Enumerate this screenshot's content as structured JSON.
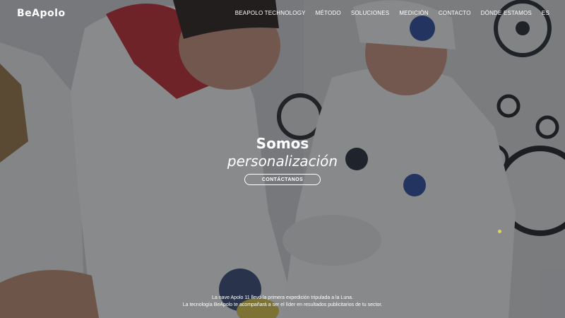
{
  "header": {
    "logo": "BeApolo",
    "nav": [
      {
        "label": "BEAPOLO TECHNOLOGY"
      },
      {
        "label": "MÉTODO"
      },
      {
        "label": "SOLUCIONES"
      },
      {
        "label": "MEDICIÓN"
      },
      {
        "label": "CONTACTO"
      },
      {
        "label": "DÓNDE ESTAMOS"
      },
      {
        "label": "ES"
      }
    ]
  },
  "hero": {
    "title": "Somos",
    "subtitle": "personalización",
    "cta_label": "CONTÁCTANOS",
    "caption_line1": "La nave Apolo 11 llevó la primera expedición tripulada a la Luna.",
    "caption_line2": "La tecnología BeApolo te acompañará a ser el líder en resultados publicitarios de tu sector.",
    "slider_dot_color": "#e8d34a",
    "background_image": "astronauts-suiting-up-photo"
  }
}
